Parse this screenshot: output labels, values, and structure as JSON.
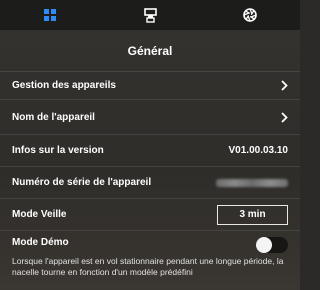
{
  "tabs": [
    {
      "icon": "grid-icon",
      "active": true
    },
    {
      "icon": "aircraft-icon",
      "active": false
    },
    {
      "icon": "aperture-icon",
      "active": false
    }
  ],
  "colors": {
    "active_tab": "#2f8bf5",
    "inactive_tab": "#ffffff"
  },
  "header": {
    "title": "Général"
  },
  "settings": {
    "device_management": {
      "label": "Gestion des appareils"
    },
    "device_name": {
      "label": "Nom de l'appareil"
    },
    "version_info": {
      "label": "Infos sur la version",
      "value": "V01.00.03.10"
    },
    "serial_number": {
      "label": "Numéro de série de l'appareil",
      "value_hidden": true
    },
    "sleep_mode": {
      "label": "Mode Veille",
      "value": "3 min"
    },
    "demo_mode": {
      "label": "Mode Démo",
      "enabled": false,
      "description": "Lorsque l'appareil est en vol stationnaire pendant une longue période, la nacelle tourne en fonction d'un modèle prédéfini"
    }
  }
}
